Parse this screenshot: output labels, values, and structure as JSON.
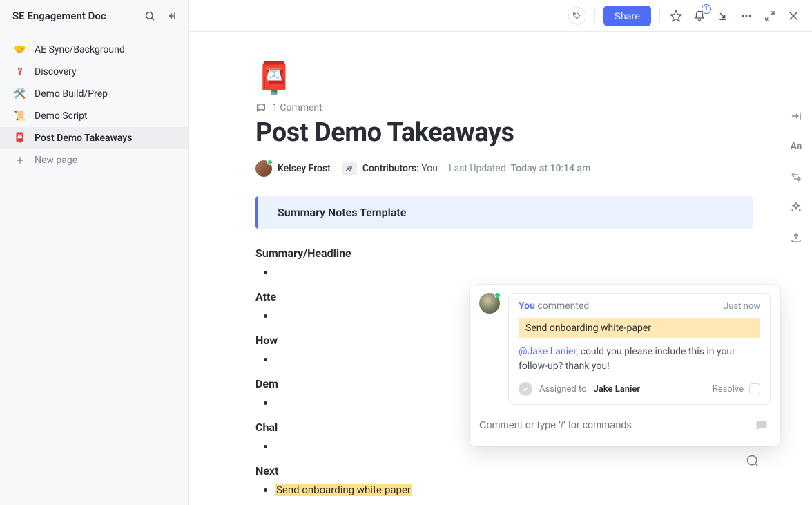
{
  "sidebar": {
    "title": "SE Engagement Doc",
    "items": [
      {
        "emoji": "🤝",
        "label": "AE Sync/Background"
      },
      {
        "emoji": "❓",
        "label": "Discovery",
        "emojiColor": "#d33"
      },
      {
        "emoji": "🛠️",
        "label": "Demo Build/Prep"
      },
      {
        "emoji": "📜",
        "label": "Demo Script"
      },
      {
        "emoji": "📮",
        "label": "Post Demo Takeaways",
        "active": true
      }
    ],
    "newPage": "New page"
  },
  "topbar": {
    "share": "Share",
    "bellCount": "1"
  },
  "page": {
    "emoji": "📮",
    "commentCount": "1 Comment",
    "title": "Post Demo Takeaways",
    "author": "Kelsey Frost",
    "contribLabel": "Contributors:",
    "contribYou": "You",
    "updatedLabel": "Last Updated:",
    "updatedValue": "Today at 10:14 am",
    "callout": "Summary Notes Template",
    "sections": [
      {
        "title": "Summary/Headline"
      },
      {
        "title": "Atte"
      },
      {
        "title": "How"
      },
      {
        "title": "Dem"
      },
      {
        "title": "Chal"
      },
      {
        "title": "Next"
      }
    ],
    "highlightedItem": "Send onboarding white-paper"
  },
  "comment": {
    "byYou": "You",
    "byAction": "commented",
    "timestamp": "Just now",
    "quoted": "Send onboarding white-paper",
    "mention": "@Jake Lanier",
    "body": ", could you please include this in your follow-up? thank you!",
    "assignedLabel": "Assigned to",
    "assignedTo": "Jake Lanier",
    "resolve": "Resolve",
    "replyPlaceholder": "Comment or type '/' for commands"
  }
}
